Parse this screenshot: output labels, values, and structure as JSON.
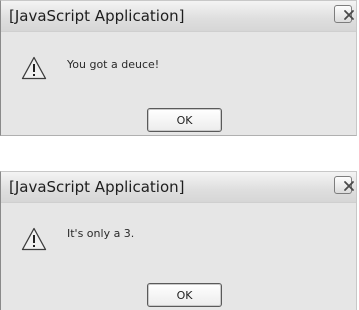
{
  "dialogs": [
    {
      "title": "[JavaScript Application]",
      "message": "You got a deuce!",
      "ok_label": "OK"
    },
    {
      "title": "[JavaScript Application]",
      "message": "It's only a 3.",
      "ok_label": "OK"
    }
  ],
  "icons": {
    "close": "close-icon",
    "warning": "warning-icon"
  }
}
